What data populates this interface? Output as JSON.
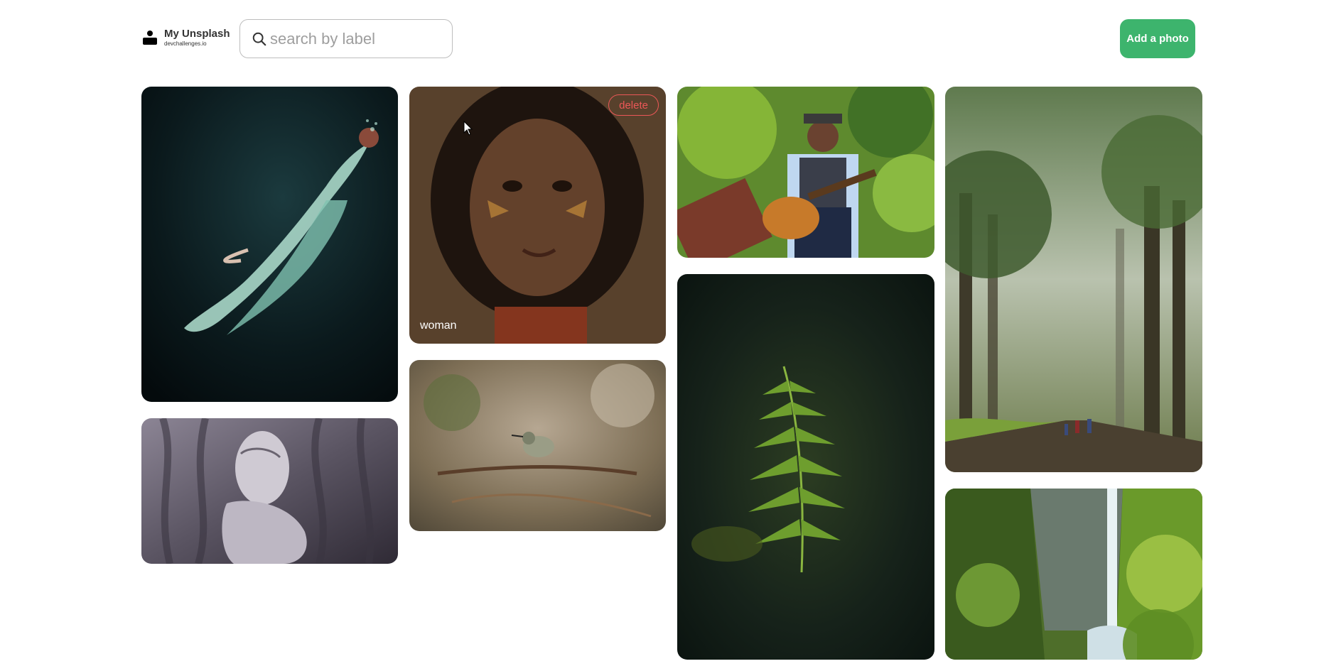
{
  "header": {
    "logo": {
      "title": "My Unsplash",
      "subtitle": "devchallenges.io",
      "icon": "person-icon"
    },
    "search": {
      "placeholder": "search by label",
      "value": "",
      "icon": "search-icon"
    },
    "add_button_label": "Add a photo"
  },
  "gallery": {
    "photos": [
      {
        "label": "",
        "subject": "woman floating underwater in green dress",
        "hovered": false
      },
      {
        "label": "",
        "subject": "woman with textured tree-bark body art",
        "hovered": false
      },
      {
        "label": "woman",
        "subject": "illustrated portrait of a woman with face paint",
        "hovered": true,
        "delete_label": "delete"
      },
      {
        "label": "",
        "subject": "hummingbird perched on branch",
        "hovered": false
      },
      {
        "label": "",
        "subject": "man in hat playing acoustic guitar",
        "hovered": false
      },
      {
        "label": "",
        "subject": "fern leaf in dark forest",
        "hovered": false
      },
      {
        "label": "",
        "subject": "cyclists on misty tree-lined road",
        "hovered": false
      },
      {
        "label": "",
        "subject": "waterfall in green cliffs",
        "hovered": false
      }
    ]
  },
  "colors": {
    "accent": "#3db46d",
    "delete": "#eb5757",
    "text": "#333333",
    "border": "#bdbdbd"
  }
}
